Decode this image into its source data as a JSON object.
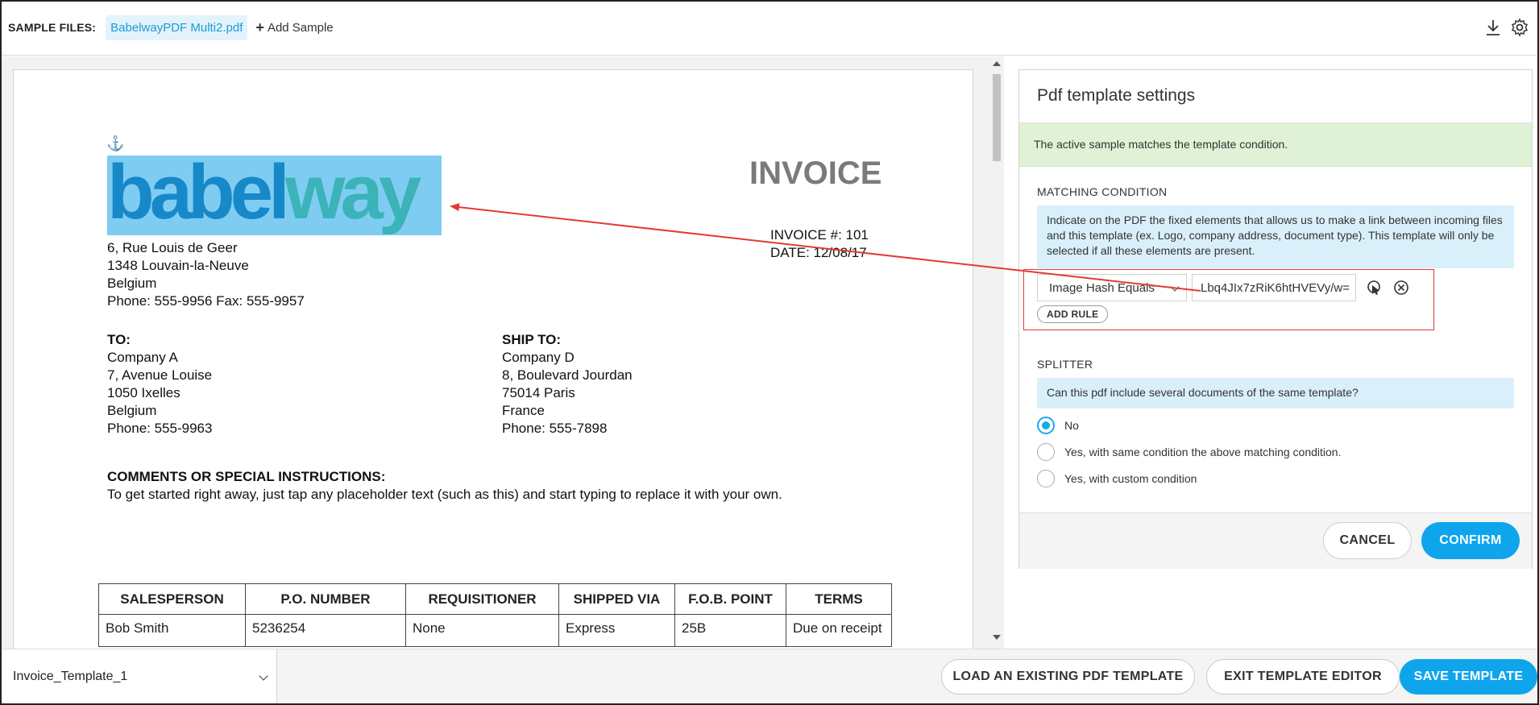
{
  "topbar": {
    "sample_files_label": "SAMPLE FILES:",
    "sample_file": "BabelwayPDF Multi2.pdf",
    "add_sample_label": "Add Sample",
    "icons": [
      "download-icon",
      "gear-icon"
    ]
  },
  "pdf": {
    "invoice_title": "INVOICE",
    "logo_text_part1": "babel",
    "logo_text_part2": "way",
    "sender_address": [
      "6, Rue Louis de Geer",
      "1348 Louvain-la-Neuve",
      "Belgium",
      "Phone: 555-9956  Fax: 555-9957"
    ],
    "invoice_number": "INVOICE #:  101",
    "invoice_date": "DATE:  12/08/17",
    "to_label": "TO:",
    "to_address": [
      "Company A",
      "7, Avenue Louise",
      "1050 Ixelles",
      "Belgium",
      "Phone:  555-9963"
    ],
    "ship_to_label": "SHIP TO:",
    "ship_to_address": [
      "Company D",
      "8, Boulevard Jourdan",
      "75014 Paris",
      "France",
      "Phone:  555-7898"
    ],
    "comments_label": "COMMENTS OR SPECIAL INSTRUCTIONS:",
    "comments_text": "To get started right away, just tap any placeholder text (such as this) and start typing to replace it with your own.",
    "table": {
      "headers": [
        "SALESPERSON",
        "P.O. NUMBER",
        "REQUISITIONER",
        "SHIPPED VIA",
        "F.O.B. POINT",
        "TERMS"
      ],
      "row": [
        "Bob Smith",
        "5236254",
        "None",
        "Express",
        "25B",
        "Due on receipt"
      ]
    }
  },
  "panel": {
    "title": "Pdf template settings",
    "match_banner": "The active sample matches the template condition.",
    "matching_condition_label": "MATCHING CONDITION",
    "matching_info": "Indicate on the PDF the fixed elements that allows us to make a link between incoming files and this template (ex. Logo, company address, document type). This template will only be selected if all these elements are present.",
    "rule_type": "Image Hash Equals",
    "rule_value": "Lbq4JIx7zRiK6htHVEVy/w=",
    "add_rule_label": "ADD RULE",
    "splitter_label": "SPLITTER",
    "splitter_question": "Can this pdf include several documents of the same template?",
    "splitter_options": [
      "No",
      "Yes, with same condition the above matching condition.",
      "Yes, with custom condition"
    ],
    "splitter_selected": "No",
    "cancel_label": "CANCEL",
    "confirm_label": "CONFIRM"
  },
  "bottombar": {
    "template_name": "Invoice_Template_1",
    "load_label": "LOAD AN EXISTING PDF TEMPLATE",
    "exit_label": "EXIT TEMPLATE EDITOR",
    "save_label": "SAVE TEMPLATE"
  },
  "colors": {
    "accent": "#0ea5ec",
    "match_banner_bg": "#dff1d6",
    "info_box_bg": "#d9f0fb",
    "annotation_red": "#e53935"
  }
}
